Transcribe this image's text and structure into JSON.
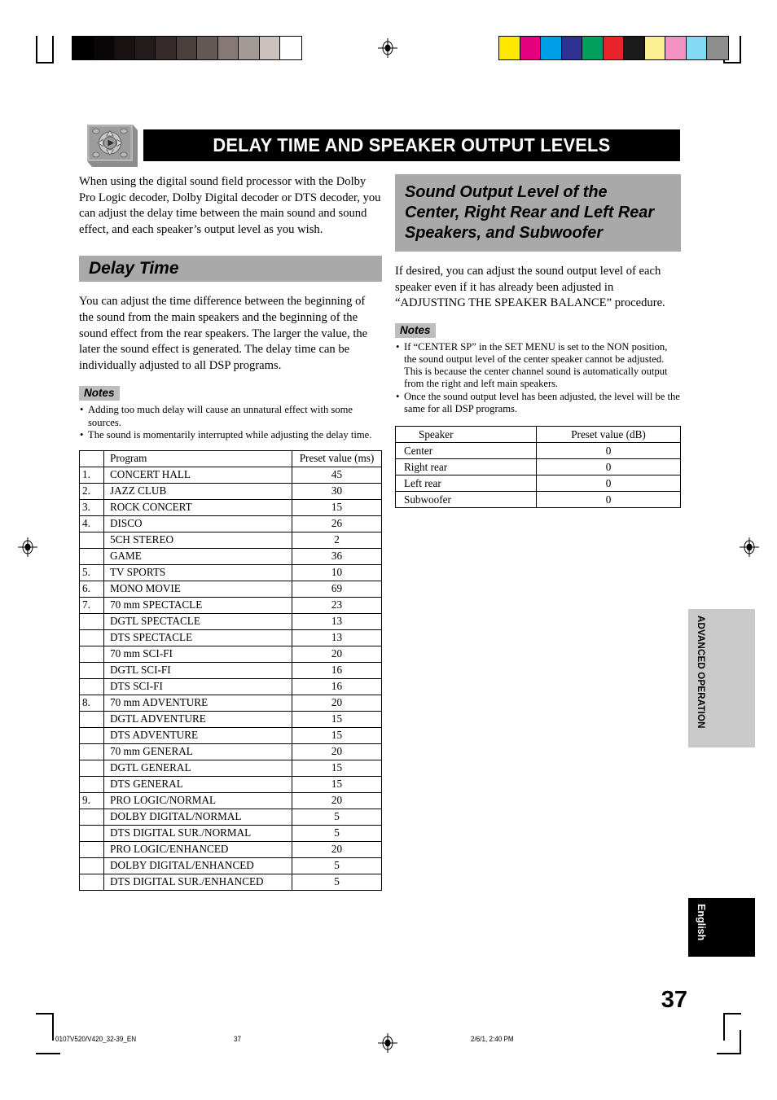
{
  "header": {
    "title": "DELAY TIME AND SPEAKER OUTPUT LEVELS",
    "icon": "remote-control-dpad-icon"
  },
  "intro": {
    "text": "When using the digital sound field processor with the Dolby Pro Logic decoder, Dolby Digital decoder or DTS decoder, you can adjust the delay time between the main sound and sound effect, and each speaker’s output level as you wish."
  },
  "left": {
    "section_heading": "Delay Time",
    "body": "You can adjust the time difference between the beginning of the sound from the main speakers and the beginning of the sound effect from the rear speakers. The larger the value, the later the sound effect is generated. The delay time can be individually adjusted to all DSP programs.",
    "notes_label": "Notes",
    "notes": [
      "Adding too much delay will cause an unnatural effect with some sources.",
      "The sound is momentarily interrupted while adjusting the delay time."
    ],
    "table": {
      "headers": [
        "",
        "Program",
        "Preset value (ms)"
      ],
      "rows": [
        {
          "num": "1.",
          "program": "CONCERT HALL",
          "value": "45"
        },
        {
          "num": "2.",
          "program": "JAZZ CLUB",
          "value": "30"
        },
        {
          "num": "3.",
          "program": "ROCK CONCERT",
          "value": "15"
        },
        {
          "num": "4.",
          "program": "DISCO",
          "value": "26"
        },
        {
          "num": "",
          "program": "5CH STEREO",
          "value": "2"
        },
        {
          "num": "",
          "program": "GAME",
          "value": "36"
        },
        {
          "num": "5.",
          "program": "TV SPORTS",
          "value": "10"
        },
        {
          "num": "6.",
          "program": "MONO MOVIE",
          "value": "69"
        },
        {
          "num": "7.",
          "program": "70 mm SPECTACLE",
          "value": "23"
        },
        {
          "num": "",
          "program": "DGTL SPECTACLE",
          "value": "13"
        },
        {
          "num": "",
          "program": "DTS SPECTACLE",
          "value": "13"
        },
        {
          "num": "",
          "program": "70 mm SCI-FI",
          "value": "20"
        },
        {
          "num": "",
          "program": "DGTL SCI-FI",
          "value": "16"
        },
        {
          "num": "",
          "program": "DTS SCI-FI",
          "value": "16"
        },
        {
          "num": "8.",
          "program": "70 mm ADVENTURE",
          "value": "20"
        },
        {
          "num": "",
          "program": "DGTL ADVENTURE",
          "value": "15"
        },
        {
          "num": "",
          "program": "DTS ADVENTURE",
          "value": "15"
        },
        {
          "num": "",
          "program": "70 mm GENERAL",
          "value": "20"
        },
        {
          "num": "",
          "program": "DGTL GENERAL",
          "value": "15"
        },
        {
          "num": "",
          "program": "DTS GENERAL",
          "value": "15"
        },
        {
          "num": "9.",
          "program": "PRO LOGIC/NORMAL",
          "value": "20"
        },
        {
          "num": "",
          "program": "DOLBY DIGITAL/NORMAL",
          "value": "5"
        },
        {
          "num": "",
          "program": "DTS DIGITAL SUR./NORMAL",
          "value": "5"
        },
        {
          "num": "",
          "program": "PRO LOGIC/ENHANCED",
          "value": "20"
        },
        {
          "num": "",
          "program": "DOLBY DIGITAL/ENHANCED",
          "value": "5"
        },
        {
          "num": "",
          "program": "DTS DIGITAL SUR./ENHANCED",
          "value": "5"
        }
      ]
    }
  },
  "right": {
    "section_heading": "Sound Output Level of the Center, Right Rear and Left Rear Speakers, and Subwoofer",
    "body": "If desired, you can adjust the sound output level of each speaker even if it has already been adjusted in “ADJUSTING THE SPEAKER BALANCE” procedure.",
    "notes_label": "Notes",
    "notes": [
      "If “CENTER SP” in the SET MENU is set to the NON position, the sound output level of the center speaker cannot be adjusted. This is because the center channel sound is automatically output from the right and left main speakers.",
      "Once the sound output level has been adjusted, the level will be the same for all DSP programs."
    ],
    "table": {
      "headers": [
        "Speaker",
        "Preset value (dB)"
      ],
      "rows": [
        {
          "speaker": "Center",
          "value": "0"
        },
        {
          "speaker": "Right rear",
          "value": "0"
        },
        {
          "speaker": "Left rear",
          "value": "0"
        },
        {
          "speaker": "Subwoofer",
          "value": "0"
        }
      ]
    }
  },
  "tabs": {
    "advanced": "ADVANCED OPERATION",
    "language": "English"
  },
  "page_number": "37",
  "footer": {
    "file": "0107V520/V420_32-39_EN",
    "page": "37",
    "date": "2/6/1, 2:40 PM"
  },
  "calibration": {
    "gray_swatches": [
      "#000000",
      "#0b0708",
      "#181213",
      "#241c1c",
      "#342a29",
      "#4b3f3d",
      "#655754",
      "#867874",
      "#a39995",
      "#cbc2be",
      "#ffffff"
    ],
    "color_swatches": [
      "#fde800",
      "#e4007f",
      "#00a0e9",
      "#2e3192",
      "#00a05a",
      "#e8242a",
      "#1a1a1a",
      "#fcef91",
      "#f293c4",
      "#84d9f5",
      "#8e8e8e"
    ]
  }
}
